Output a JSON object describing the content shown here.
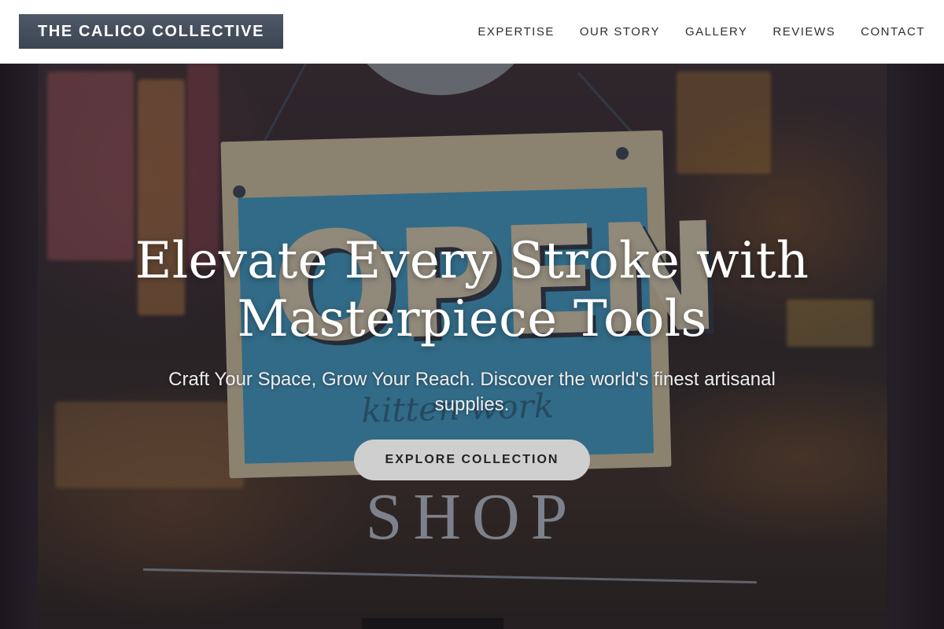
{
  "header": {
    "brand": "THE CALICO COLLECTIVE",
    "nav": [
      {
        "label": "EXPERTISE"
      },
      {
        "label": "OUR STORY"
      },
      {
        "label": "GALLERY"
      },
      {
        "label": "REVIEWS"
      },
      {
        "label": "CONTACT"
      }
    ]
  },
  "hero": {
    "title_line1": "Elevate Every Stroke with",
    "title_line2": "Masterpiece Tools",
    "subtitle": "Craft Your Space, Grow Your Reach. Discover the world's finest artisanal supplies.",
    "cta_label": "EXPLORE COLLECTION",
    "background": {
      "sign_text": "OPEN",
      "sign_script": "kitten work",
      "door_text": "SHOP"
    }
  },
  "colors": {
    "brand_bg": "#444d59",
    "nav_text": "#2e2e2e",
    "cta_bg": "#cfcfcf",
    "hero_text": "#ffffff"
  }
}
